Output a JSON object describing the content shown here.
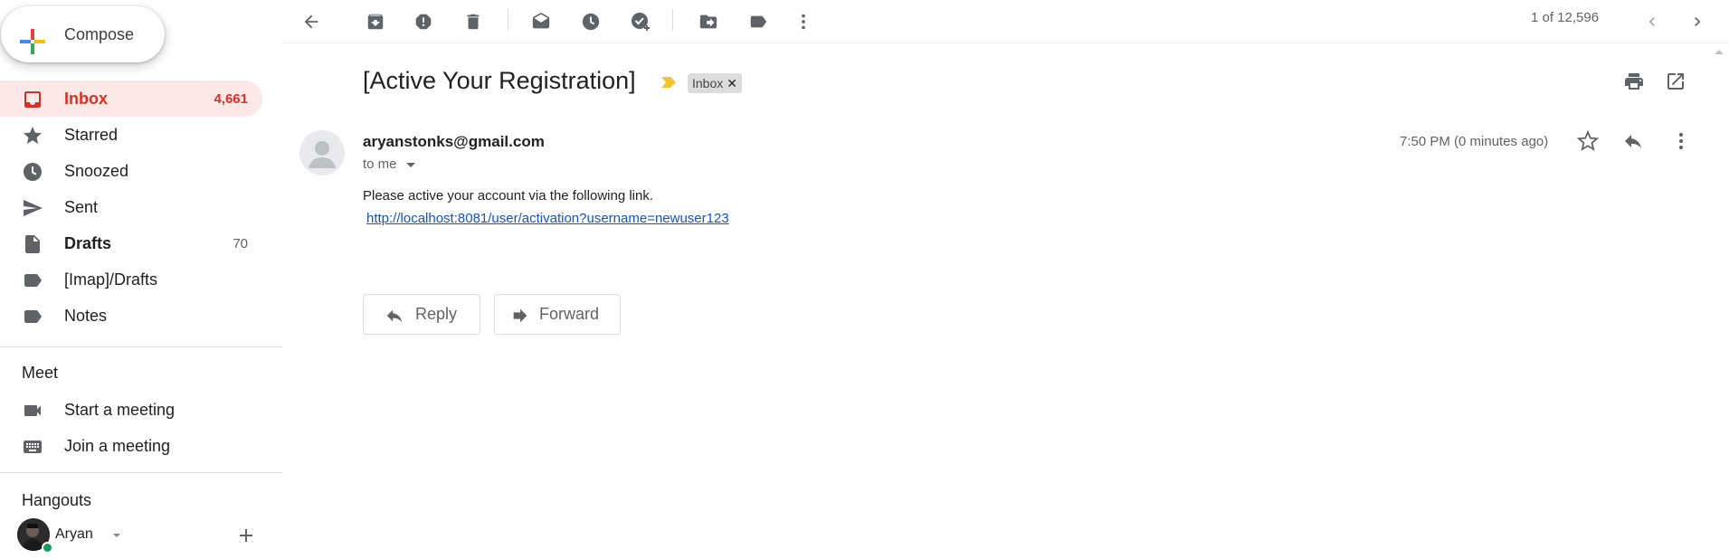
{
  "compose": {
    "label": "Compose"
  },
  "sidebar": {
    "items": [
      {
        "label": "Inbox",
        "count": "4,661"
      },
      {
        "label": "Starred",
        "count": ""
      },
      {
        "label": "Snoozed",
        "count": ""
      },
      {
        "label": "Sent",
        "count": ""
      },
      {
        "label": "Drafts",
        "count": "70"
      },
      {
        "label": "[Imap]/Drafts",
        "count": ""
      },
      {
        "label": "Notes",
        "count": ""
      }
    ],
    "meet": {
      "title": "Meet",
      "items": [
        {
          "label": "Start a meeting"
        },
        {
          "label": "Join a meeting"
        }
      ]
    },
    "hangouts": {
      "title": "Hangouts",
      "user": "Aryan"
    }
  },
  "toolbar": {
    "pagination": "1 of 12,596"
  },
  "message": {
    "subject": "[Active Your Registration]",
    "label_chip": "Inbox",
    "sender": "aryanstonks@gmail.com",
    "to": "to me",
    "time": "7:50 PM (0 minutes ago)",
    "body": "Please active your account via the following link.",
    "link": "http://localhost:8081/user/activation?username=newuser123"
  },
  "actions": {
    "reply": "Reply",
    "forward": "Forward"
  },
  "colors": {
    "accent": "#d93025",
    "active_bg": "#fce8e6",
    "link": "#1155cc",
    "important": "#f4c430",
    "presence": "#0f9d58"
  },
  "icons": [
    "compose-plus-icon",
    "inbox-icon",
    "star-icon",
    "clock-icon",
    "send-icon",
    "draft-icon",
    "label-icon",
    "video-icon",
    "keyboard-icon",
    "back-arrow-icon",
    "archive-icon",
    "report-spam-icon",
    "delete-icon",
    "mark-unread-icon",
    "snooze-icon",
    "add-task-icon",
    "move-to-icon",
    "labels-icon",
    "more-vert-icon",
    "chevron-left-icon",
    "chevron-right-icon",
    "print-icon",
    "open-new-window-icon",
    "reply-icon",
    "forward-icon"
  ]
}
